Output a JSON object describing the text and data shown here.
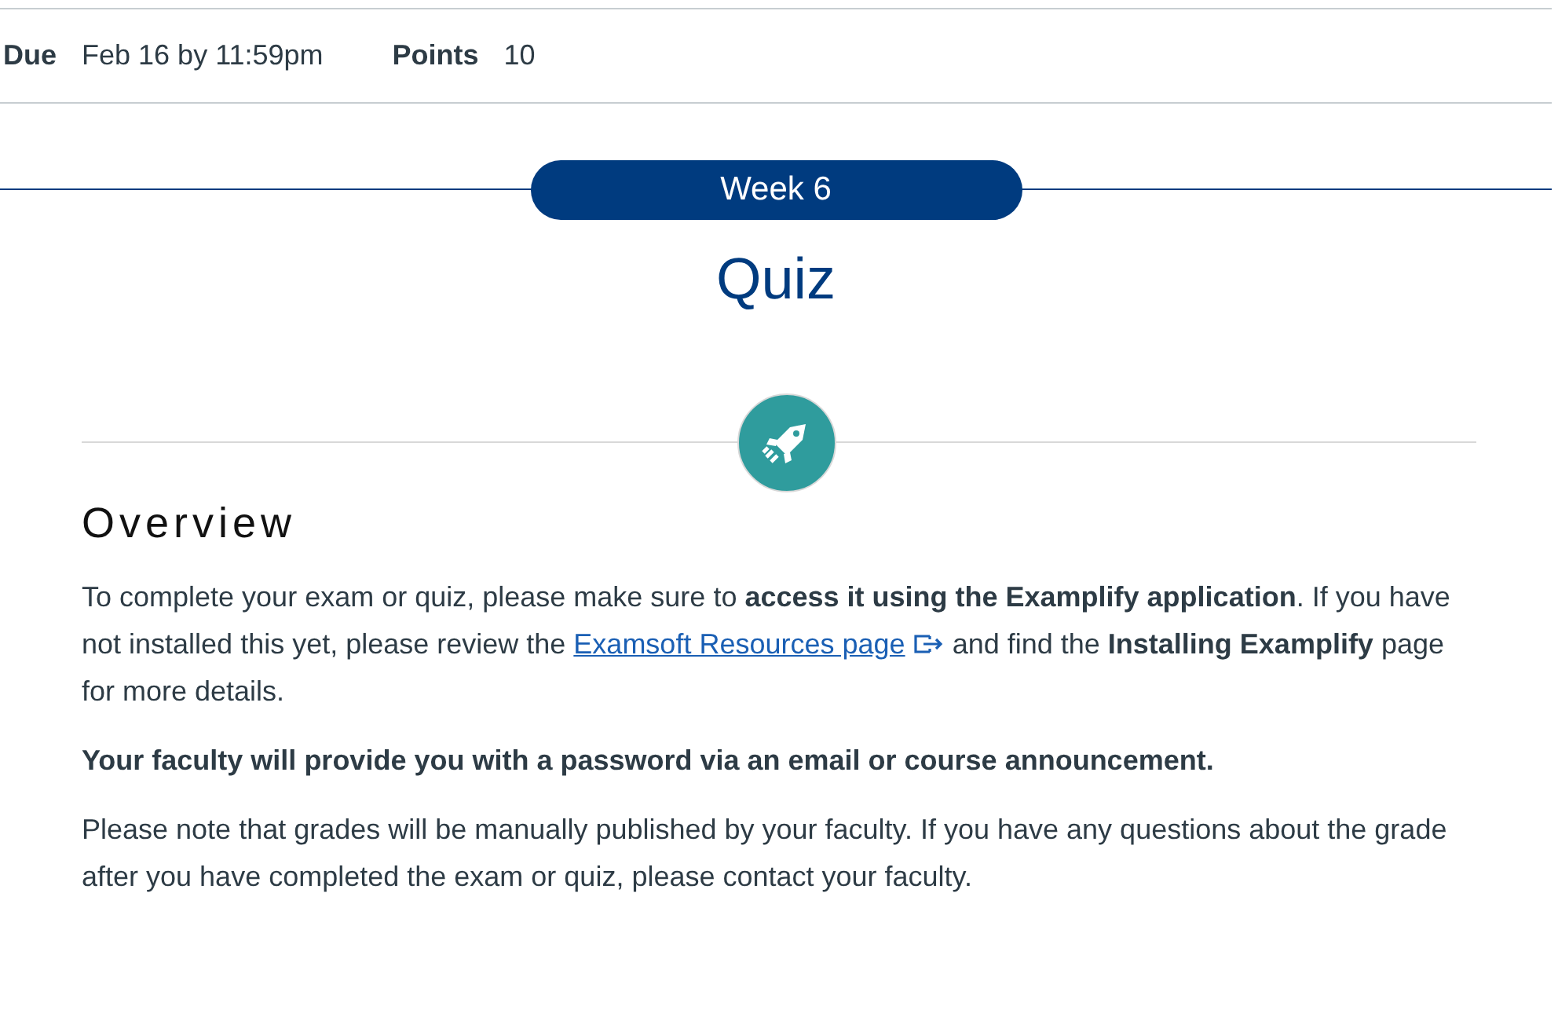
{
  "meta": [
    {
      "label": "Due",
      "value": "Feb 16 by 11:59pm"
    },
    {
      "label": "Points",
      "value": "10"
    }
  ],
  "banner": {
    "label": "Week 6"
  },
  "title": "Quiz",
  "section": {
    "heading": "Overview",
    "paragraphs": [
      {
        "kind": "link",
        "before": "To complete your exam or quiz, please make sure to **access it using the Examplify application**. If you have not installed this yet, please review the",
        "link": "Examsoft Resources page",
        "after": "and find the **Installing Examplify** page for more details."
      },
      {
        "kind": "bold",
        "text": "Your faculty will provide you with a password via an email or course announcement."
      },
      {
        "kind": "plain",
        "text": "Please note that grades will be manually published by your faculty. If you have any questions about the grade after you have completed the exam or quiz, please contact your faculty."
      }
    ]
  }
}
